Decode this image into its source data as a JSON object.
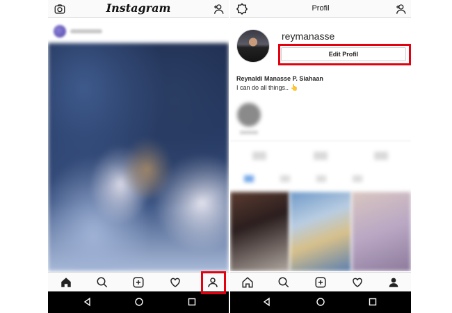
{
  "left_screen": {
    "app_title": "Instagram",
    "top_icons": {
      "left": "camera-icon",
      "right": "add-person-icon"
    },
    "nav": [
      "home-icon",
      "search-icon",
      "add-post-icon",
      "heart-icon",
      "profile-icon"
    ],
    "active_nav": "home-icon",
    "highlighted_nav": "profile-icon"
  },
  "right_screen": {
    "title": "Profil",
    "top_icons": {
      "left": "settings-icon",
      "right": "add-person-icon"
    },
    "profile": {
      "username": "reymanasse",
      "edit_button_label": "Edit Profil",
      "full_name": "Reynaldi Manasse P. Siahaan",
      "bio": "I can do all things..",
      "bio_emoji": "👆"
    },
    "nav": [
      "home-icon",
      "search-icon",
      "add-post-icon",
      "heart-icon",
      "profile-icon"
    ],
    "active_nav": "profile-icon",
    "highlighted_element": "edit-profile-button"
  },
  "system_nav": [
    "back-icon",
    "home-circle-icon",
    "recents-icon"
  ],
  "colors": {
    "highlight": "#e3000f",
    "text": "#262626",
    "system_bar": "#000000"
  }
}
